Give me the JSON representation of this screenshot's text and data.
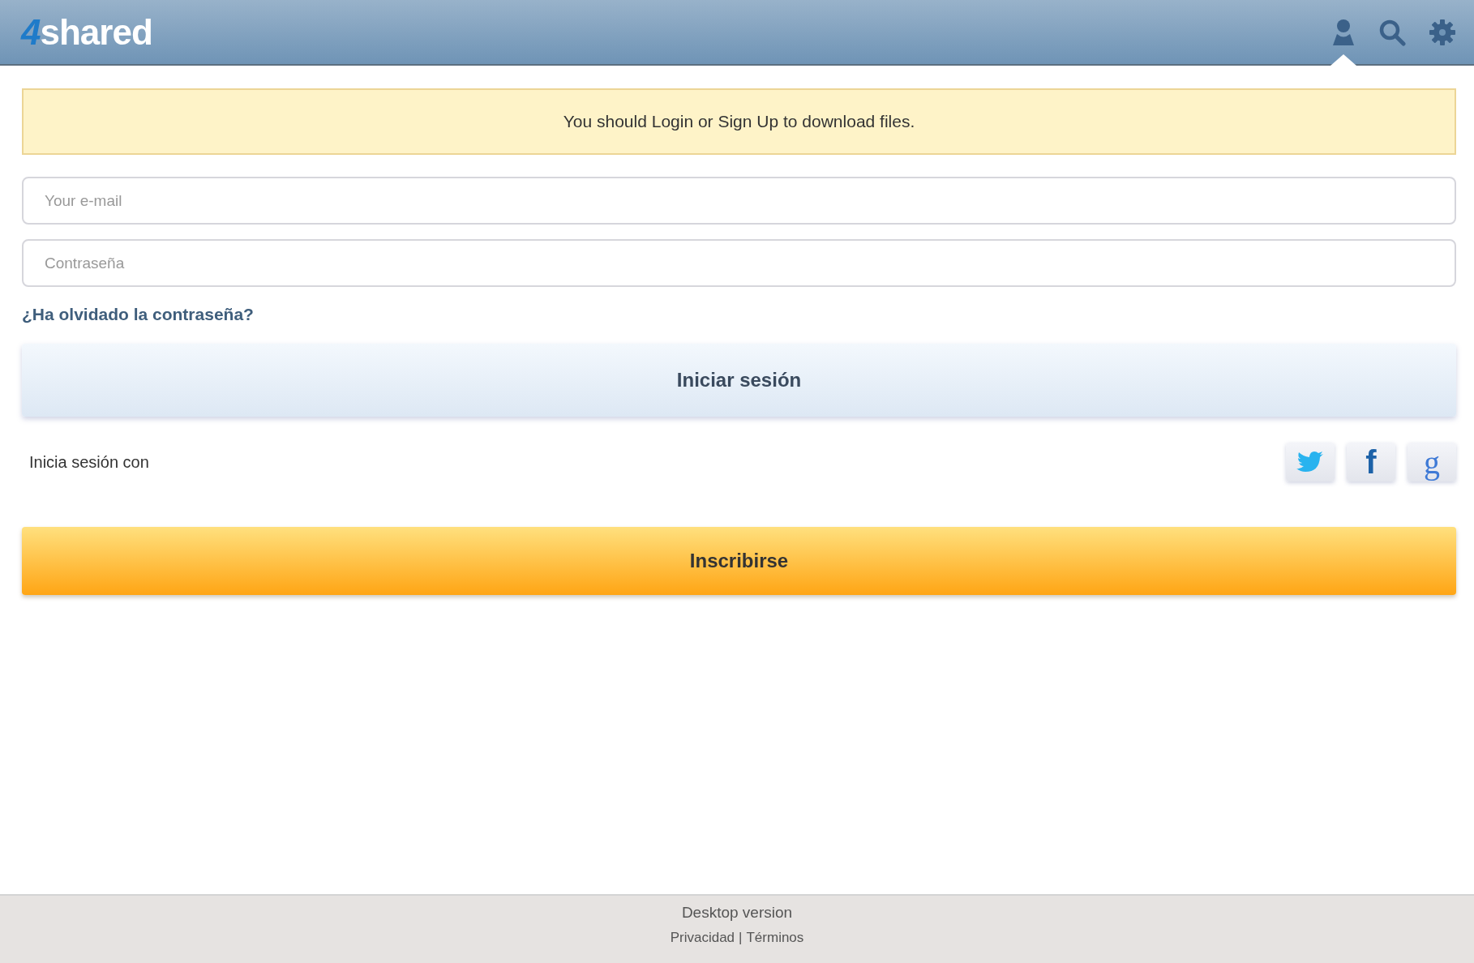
{
  "header": {
    "logo": {
      "number": "4",
      "word": "shared"
    },
    "icons": [
      {
        "kind": "user",
        "selected": true
      },
      {
        "kind": "search",
        "selected": false
      },
      {
        "kind": "settings",
        "selected": false
      }
    ]
  },
  "notice": "You should Login or Sign Up to download files.",
  "form": {
    "email": {
      "placeholder": "Your e-mail"
    },
    "password": {
      "placeholder": "Contraseña"
    },
    "forgot_link": "¿Ha olvidado la contraseña?",
    "login_button": "Iniciar sesión"
  },
  "social": {
    "label": "Inicia sesión con",
    "buttons": [
      {
        "kind": "twitter"
      },
      {
        "kind": "facebook",
        "glyph": "f"
      },
      {
        "kind": "google",
        "glyph": "g"
      }
    ]
  },
  "signup_button": "Inscribirse",
  "footer": {
    "desktop_link": "Desktop version",
    "links": [
      "Privacidad",
      "Términos"
    ],
    "separator": "|"
  }
}
